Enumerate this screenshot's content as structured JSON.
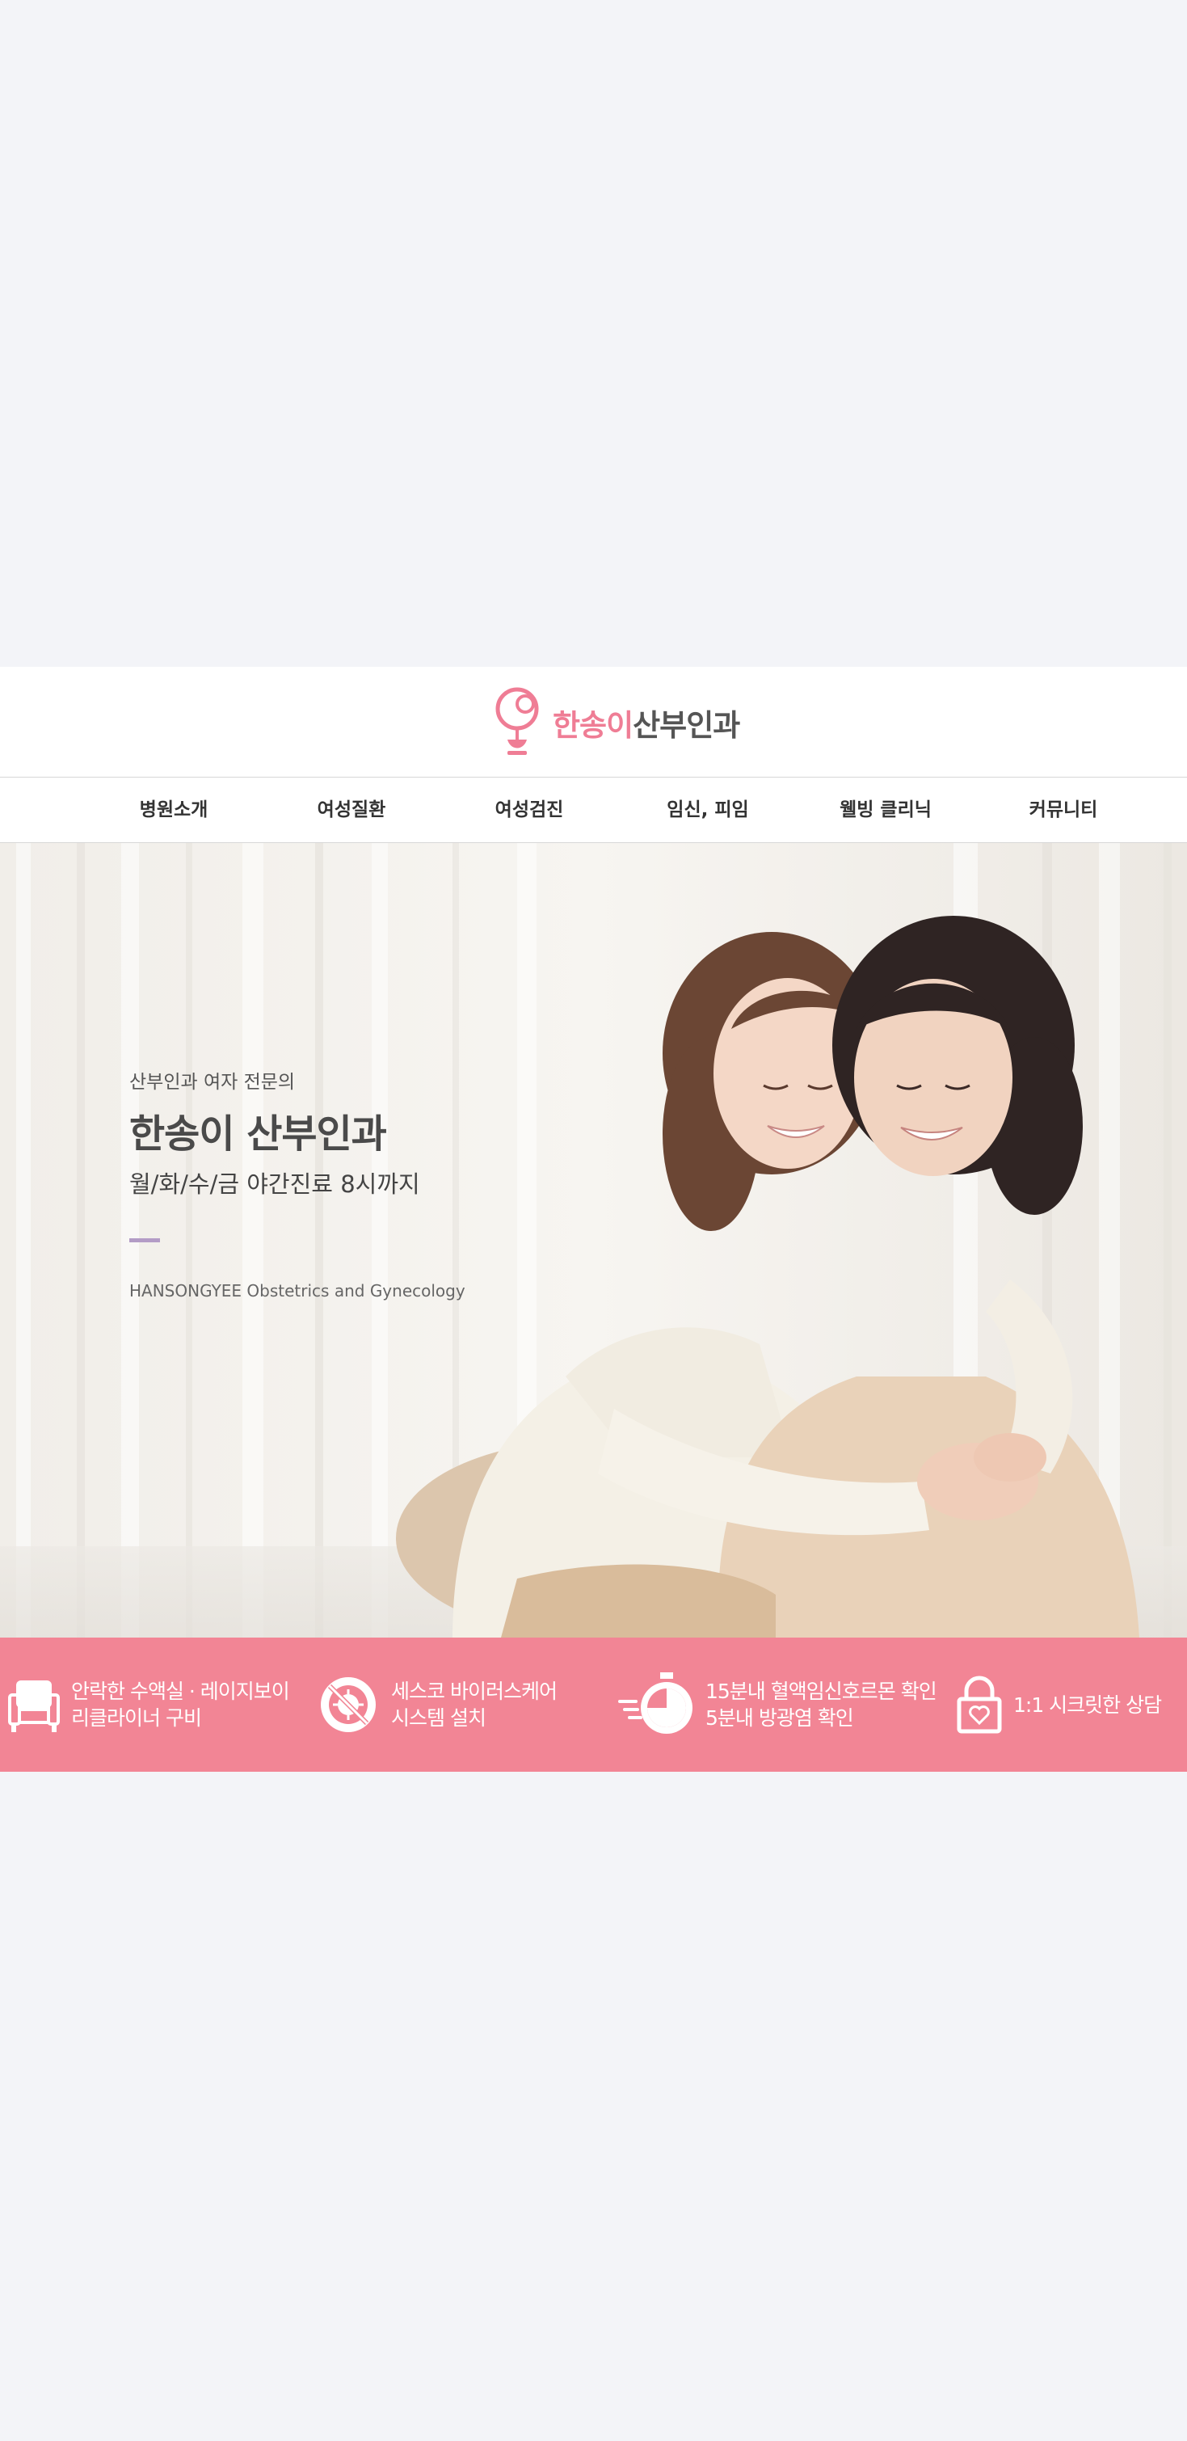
{
  "header": {
    "logo_pink": "한송이",
    "logo_gray": "산부인과"
  },
  "nav": {
    "items": [
      {
        "label": "병원소개"
      },
      {
        "label": "여성질환"
      },
      {
        "label": "여성검진"
      },
      {
        "label": "임신, 피임"
      },
      {
        "label": "웰빙 클리닉"
      },
      {
        "label": "커뮤니티"
      }
    ]
  },
  "hero": {
    "subtitle": "산부인과 여자 전문의",
    "title": "한송이 산부인과",
    "hours": "월/화/수/금 야간진료 8시까지",
    "english_name": "HANSONGYEE Obstetrics and Gynecology"
  },
  "features": {
    "items": [
      {
        "icon": "armchair-icon",
        "line1": "안락한 수액실 · 레이지보이",
        "line2": "리클라이너 구비"
      },
      {
        "icon": "no-virus-icon",
        "line1": "세스코 바이러스케어",
        "line2": "시스템 설치"
      },
      {
        "icon": "stopwatch-icon",
        "line1": "15분내 혈액임신호르몬 확인",
        "line2": "5분내 방광염 확인"
      },
      {
        "icon": "heart-lock-icon",
        "line1": "1:1 시크릿한 상담",
        "line2": ""
      }
    ]
  },
  "colors": {
    "brand_pink": "#ef7d95",
    "feature_bar": "#f28595",
    "accent_purple": "#b39cc6"
  }
}
